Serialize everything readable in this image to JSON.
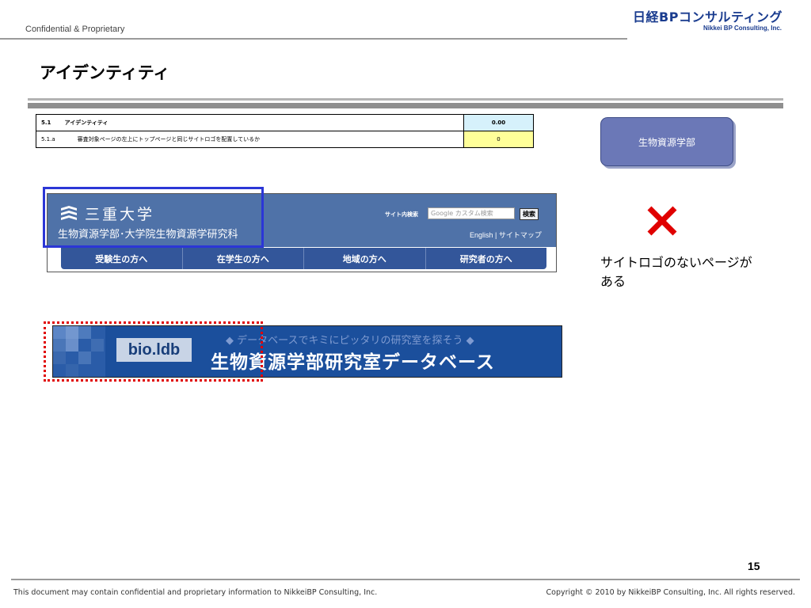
{
  "header": {
    "confidential": "Confidential & Proprietary",
    "brand_main": "日経BPコンサルティング",
    "brand_sub": "Nikkei BP Consulting, Inc."
  },
  "page_title": "アイデンティティ",
  "eval_table": {
    "rows": [
      {
        "num": "5.1",
        "label": "アイデンティティ",
        "score": "0.00"
      },
      {
        "num": "5.1.a",
        "label": "審査対象ページの左上にトップページと同じサイトロゴを配置しているか",
        "score": "0"
      }
    ]
  },
  "dept_box": "生物資源学部",
  "site_header": {
    "university": "三重大学",
    "department": "生物資源学部･大学院生物資源学研究科",
    "search_label": "サイト内検索",
    "search_placeholder": "Google カスタム検索",
    "search_button": "検索",
    "links": "English | サイトマップ",
    "nav": [
      "受験生の方へ",
      "在学生の方へ",
      "地域の方へ",
      "研究者の方へ"
    ]
  },
  "note": "サイトロゴのないページがある",
  "db_banner": {
    "logo": "bio.ldb",
    "tagline": "◆ データベースでキミにピッタリの研究室を探そう ◆",
    "title": "生物資源学部研究室データベース"
  },
  "page_number": "15",
  "footer": {
    "left": "This document may contain confidential and proprietary information to NikkeiBP Consulting, Inc.",
    "right": "Copyright © 2010 by NikkeiBP Consulting, Inc. All rights reserved."
  },
  "colors": {
    "highlight_blue": "#2b36d6",
    "highlight_red": "#e00000",
    "score_header_bg": "#d6f1fb",
    "score_row_bg": "#ffff99",
    "dept_box_bg": "#6b78b7"
  }
}
